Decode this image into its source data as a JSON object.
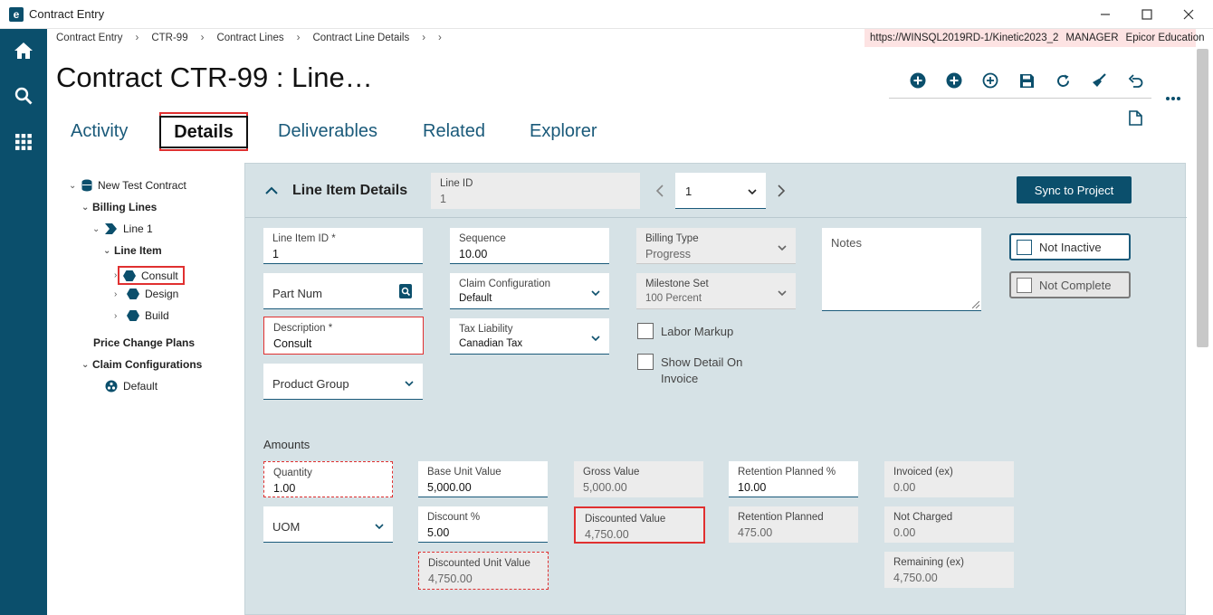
{
  "window": {
    "title": "Contract Entry",
    "logo_letter": "e"
  },
  "breadcrumb": [
    "Contract Entry",
    "CTR-99",
    "Contract Lines",
    "Contract Line Details"
  ],
  "server": {
    "url": "https://WINSQL2019RD-1/Kinetic2023_2",
    "user": "MANAGER",
    "company": "Epicor Education"
  },
  "page_title": "Contract CTR-99 : Line…",
  "tabs": [
    "Activity",
    "Details",
    "Deliverables",
    "Related",
    "Explorer"
  ],
  "active_tab": "Details",
  "tree": {
    "root": "New Test Contract",
    "billing_lines": "Billing Lines",
    "line1": "Line 1",
    "line_item": "Line Item",
    "consult": "Consult",
    "design": "Design",
    "build": "Build",
    "price_change_plans": "Price Change Plans",
    "claim_configurations": "Claim Configurations",
    "default": "Default"
  },
  "panel": {
    "title": "Line Item Details",
    "line_id_label": "Line ID",
    "line_id_value": "1",
    "line_selector": "1",
    "sync_button": "Sync to Project"
  },
  "fields": {
    "line_item_id": {
      "label": "Line Item ID *",
      "value": "1"
    },
    "part_num": {
      "placeholder": "Part Num"
    },
    "description": {
      "label": "Description *",
      "value": "Consult"
    },
    "product_group": {
      "placeholder": "Product Group"
    },
    "sequence": {
      "label": "Sequence",
      "value": "10.00"
    },
    "claim_configuration": {
      "label": "Claim Configuration",
      "value": "Default"
    },
    "tax_liability": {
      "label": "Tax Liability",
      "value": "Canadian Tax"
    },
    "billing_type": {
      "label": "Billing Type",
      "value": "Progress"
    },
    "milestone_set": {
      "label": "Milestone Set",
      "value": "100 Percent"
    },
    "labor_markup": "Labor Markup",
    "show_detail_line1": "Show Detail On",
    "show_detail_line2": "Invoice",
    "notes": {
      "placeholder": "Notes"
    },
    "not_inactive": "Not Inactive",
    "not_complete": "Not Complete"
  },
  "amounts": {
    "title": "Amounts",
    "quantity": {
      "label": "Quantity",
      "value": "1.00"
    },
    "uom": {
      "placeholder": "UOM"
    },
    "base_unit_value": {
      "label": "Base Unit Value",
      "value": "5,000.00"
    },
    "discount_pct": {
      "label": "Discount %",
      "value": "5.00"
    },
    "discounted_unit_value": {
      "label": "Discounted Unit Value",
      "value": "4,750.00"
    },
    "gross_value": {
      "label": "Gross Value",
      "value": "5,000.00"
    },
    "discounted_value": {
      "label": "Discounted Value",
      "value": "4,750.00"
    },
    "retention_planned_pct": {
      "label": "Retention Planned %",
      "value": "10.00"
    },
    "retention_planned": {
      "label": "Retention Planned",
      "value": "475.00"
    },
    "invoiced_ex": {
      "label": "Invoiced (ex)",
      "value": "0.00"
    },
    "not_charged": {
      "label": "Not Charged",
      "value": "0.00"
    },
    "remaining_ex": {
      "label": "Remaining (ex)",
      "value": "4,750.00"
    }
  },
  "colors": {
    "brand": "#0b4f6c",
    "highlight_red": "#e03030",
    "panel_bg": "#d6e2e6"
  }
}
